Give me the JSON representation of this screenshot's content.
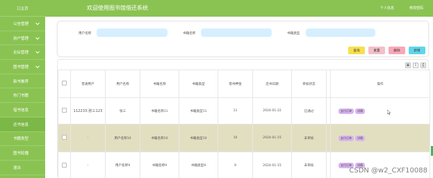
{
  "sidebar": {
    "home": "口主页",
    "items": [
      {
        "label": "公告管理",
        "chevron": true
      },
      {
        "label": "用户管理",
        "chevron": true
      },
      {
        "label": "论坛管理",
        "chevron": true
      },
      {
        "label": "图书管理",
        "chevron": true
      },
      {
        "label": "新书推荐",
        "chevron": false
      },
      {
        "label": "热门书籍",
        "chevron": false
      },
      {
        "label": "借书信息",
        "chevron": false
      },
      {
        "label": "还书信息",
        "chevron": false,
        "active": true
      },
      {
        "label": "书籍类型",
        "chevron": false
      },
      {
        "label": "图书轮播",
        "chevron": false
      },
      {
        "label": "退出",
        "chevron": false
      }
    ]
  },
  "header": {
    "title": "欢迎使用图书馆借还系统",
    "links": [
      "个人信息",
      "修改密码"
    ]
  },
  "search": {
    "fields": [
      {
        "label": "用户名称",
        "value": ""
      },
      {
        "label": "书籍名称",
        "value": ""
      },
      {
        "label": "书籍类型",
        "value": ""
      }
    ],
    "buttons": [
      {
        "label": "查询",
        "color": "#f7e04d"
      },
      {
        "label": "重置",
        "color": "#f2c0c8"
      },
      {
        "label": "删除",
        "color": "#f8a8b8"
      },
      {
        "label": "新增",
        "color": "#5fd6ea"
      }
    ]
  },
  "table": {
    "tool_icons": [
      "grid-icon",
      "export-icon",
      "print-icon"
    ],
    "columns": [
      "",
      "普通用户",
      "用户名称",
      "书籍名称",
      "书籍类型",
      "借书押金",
      "还书日期",
      "审核状态",
      "",
      "操作"
    ],
    "rows": [
      {
        "user": "112233-张三123",
        "name": "张三",
        "book": "书籍名称11",
        "type": "书籍类型11",
        "deposit": "11",
        "date": "2024-01-22",
        "status": "已通过",
        "actions": [
          "支付订单",
          "详情"
        ]
      },
      {
        "user": "-",
        "name": "用户名称10",
        "book": "书籍名称10",
        "type": "书籍类型10",
        "deposit": "10",
        "date": "2024-01-15",
        "status": "未审核",
        "actions": [
          "支付订单",
          "详情"
        ]
      },
      {
        "user": "-",
        "name": "用户名称9",
        "book": "书籍名称9",
        "type": "书籍类型9",
        "deposit": "9",
        "date": "2024-01-15",
        "status": "未审核",
        "actions": [
          "支付订单",
          "详情"
        ]
      }
    ]
  },
  "watermark": "CSDN @w2_CXF10088",
  "colors": {
    "sidebar": "#8ac352",
    "highlight_row": "#e2dfc1",
    "input_bg": "#d6efff",
    "action_btn": "#d9b5f0"
  }
}
